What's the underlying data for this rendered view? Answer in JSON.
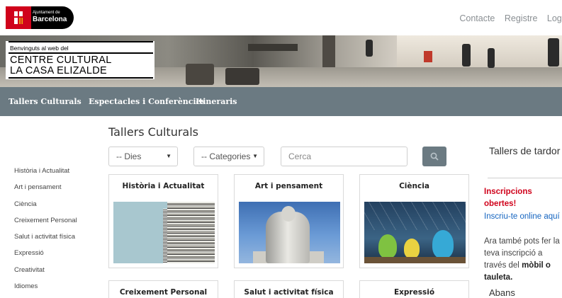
{
  "header": {
    "logo": {
      "line1": "Ajuntament de",
      "line2": "Barcelona"
    },
    "links": [
      "Contacte",
      "Registre",
      "Log i"
    ]
  },
  "banner": {
    "welcome": "Benvinguts al web del",
    "title_line1": "CENTRE CULTURAL",
    "title_line2": "LA CASA ELIZALDE"
  },
  "nav": {
    "items": [
      "Tallers Culturals",
      "Espectacles i Conferències",
      "Itineraris"
    ]
  },
  "sidebar": {
    "items": [
      "Història i Actualitat",
      "Art i pensament",
      "Ciència",
      "Creixement Personal",
      "Salut i activitat física",
      "Expressió",
      "Creativitat",
      "Idiomes"
    ]
  },
  "main": {
    "title": "Tallers Culturals",
    "filters": {
      "days": "-- Dies",
      "categories": "-- Categories",
      "search_placeholder": "Cerca"
    },
    "cards": [
      {
        "title": "Història i Actualitat",
        "image": "newspapers"
      },
      {
        "title": "Art i pensament",
        "image": "statue"
      },
      {
        "title": "Ciència",
        "image": "science-flasks"
      },
      {
        "title": "Creixement Personal"
      },
      {
        "title": "Salut i activitat física"
      },
      {
        "title": "Expressió"
      }
    ]
  },
  "aside": {
    "title": "Tallers de tardor",
    "inscriptions_line1": "Inscripcions",
    "inscriptions_line2": "obertes!",
    "online_link": "Inscriu-te online aquí",
    "note_line1": "Ara també pots fer la",
    "note_line2": "teva inscripció a",
    "note_line3_pre": "través del ",
    "note_line3_bold": "mòbil o",
    "note_line4_bold": "tauleta.",
    "abans": "Abans"
  },
  "colors": {
    "nav_bg": "#6b7a82",
    "brand_red": "#d0021b",
    "link_blue": "#1565c0"
  }
}
